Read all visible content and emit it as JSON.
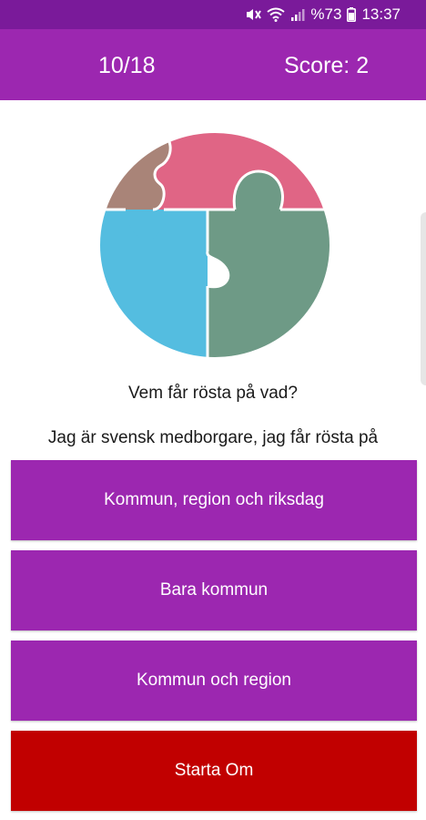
{
  "status_bar": {
    "battery_percent": "%73",
    "time": "13:37",
    "icons": [
      "mute-icon",
      "wifi-icon",
      "signal-icon",
      "battery-icon"
    ]
  },
  "header": {
    "progress": "10/18",
    "score": "Score: 2"
  },
  "puzzle_colors": {
    "pink": "#e06585",
    "brown": "#a98478",
    "green": "#6e9a86",
    "blue": "#54bde0"
  },
  "quiz": {
    "question": "Vem får rösta på vad?",
    "prompt": "Jag är svensk medborgare, jag får rösta på",
    "answers": [
      "Kommun, region och riksdag",
      "Bara kommun",
      "Kommun och region"
    ],
    "restart_label": "Starta Om"
  },
  "colors": {
    "status_bar": "#7a1a9a",
    "app_bar": "#9c27b0",
    "answer_button": "#9c27b0",
    "restart_button": "#c10000"
  }
}
